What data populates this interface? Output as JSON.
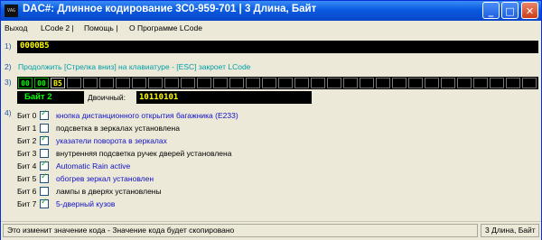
{
  "window": {
    "title": "DAC#: Длинное кодирование  3C0-959-701  | 3 Длина, Байт",
    "icon_text": "VAG"
  },
  "menu": [
    {
      "label": "Выход"
    },
    {
      "label": "LCode 2 |"
    },
    {
      "label": "Помощь |"
    },
    {
      "label": "О Программе LCode"
    }
  ],
  "section_numbers": [
    "1)",
    "2)",
    "3)",
    "4)"
  ],
  "code_field": {
    "value": "0000B5"
  },
  "instructions": "Продолжить [Стрелка вниз] на клавиатуре - [ESC] закроет LCode",
  "hex_bytes": [
    {
      "value": "00",
      "state": "normal"
    },
    {
      "value": "00",
      "state": "normal"
    },
    {
      "value": "B5",
      "state": "selected"
    }
  ],
  "byte_label": "Байт 2",
  "binary": {
    "label": "Двоичный:",
    "value": "10110101"
  },
  "bits": [
    {
      "label": "Бит 0",
      "checked": true,
      "text": "кнопка дистанционного открытия багажника (E233)"
    },
    {
      "label": "Бит 1",
      "checked": false,
      "text": "подсветка в зеркалах установлена"
    },
    {
      "label": "Бит 2",
      "checked": true,
      "text": "указатели поворота в зеркалах"
    },
    {
      "label": "Бит 3",
      "checked": false,
      "text": "внутренняя подсветка ручек дверей установлена"
    },
    {
      "label": "Бит 4",
      "checked": true,
      "text": "Automatic Rain active"
    },
    {
      "label": "Бит 5",
      "checked": true,
      "text": "обогрев зеркал установлен"
    },
    {
      "label": "Бит 6",
      "checked": false,
      "text": "лампы в дверях установлены"
    },
    {
      "label": "Бит 7",
      "checked": true,
      "text": "5-дверный кузов"
    }
  ],
  "status": {
    "main": "Это изменит значение кода - Значение кода будет скопировано",
    "right": "3 Длина, Байт"
  }
}
